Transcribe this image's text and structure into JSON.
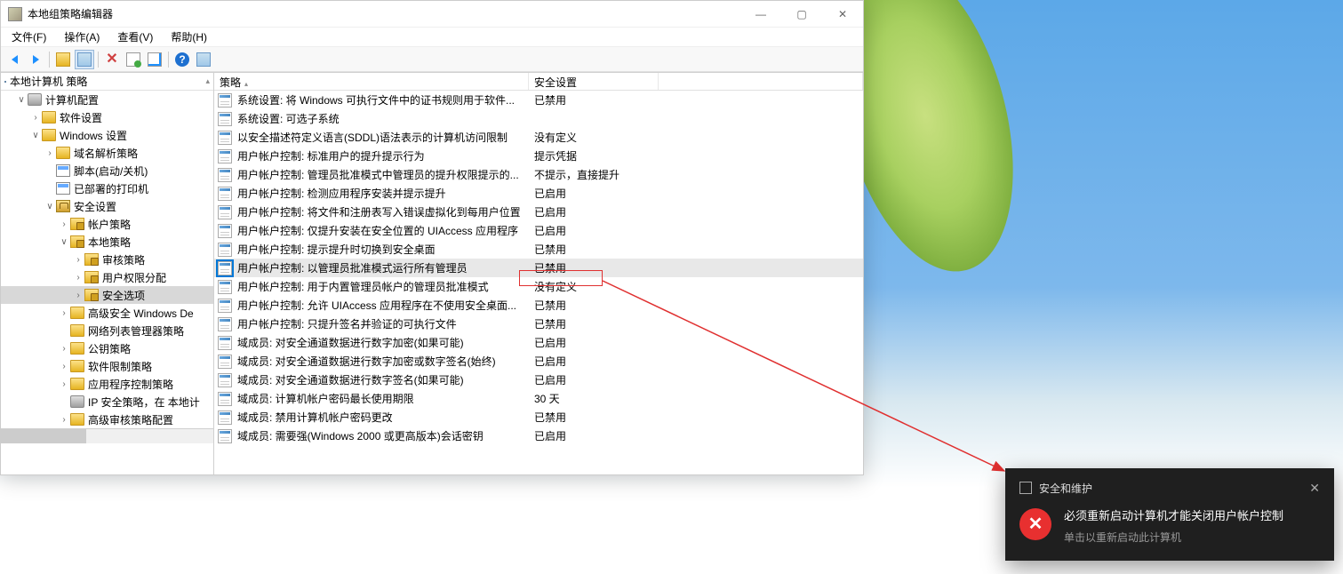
{
  "window": {
    "title": "本地组策略编辑器",
    "menus": [
      "文件(F)",
      "操作(A)",
      "查看(V)",
      "帮助(H)"
    ],
    "min": "—",
    "max": "▢",
    "close": "✕"
  },
  "tree": {
    "root": "本地计算机 策略",
    "n_computer": "计算机配置",
    "n_software": "软件设置",
    "n_windows": "Windows 设置",
    "n_dns": "域名解析策略",
    "n_script": "脚本(启动/关机)",
    "n_printer": "已部署的打印机",
    "n_security": "安全设置",
    "n_account": "帐户策略",
    "n_local": "本地策略",
    "n_audit": "审核策略",
    "n_rights": "用户权限分配",
    "n_options": "安全选项",
    "n_winde": "高级安全 Windows De",
    "n_netlist": "网络列表管理器策略",
    "n_pubkey": "公钥策略",
    "n_swrestrict": "软件限制策略",
    "n_appctrl": "应用程序控制策略",
    "n_ipsec": "IP 安全策略，在 本地计",
    "n_advaudit": "高级审核策略配置"
  },
  "list": {
    "col_policy": "策略",
    "col_setting": "安全设置",
    "rows": [
      {
        "p": "系统设置: 将 Windows 可执行文件中的证书规则用于软件...",
        "s": "已禁用"
      },
      {
        "p": "系统设置: 可选子系统",
        "s": ""
      },
      {
        "p": "以安全描述符定义语言(SDDL)语法表示的计算机访问限制",
        "s": "没有定义"
      },
      {
        "p": "用户帐户控制: 标准用户的提升提示行为",
        "s": "提示凭据"
      },
      {
        "p": "用户帐户控制: 管理员批准模式中管理员的提升权限提示的...",
        "s": "不提示，直接提升"
      },
      {
        "p": "用户帐户控制: 检测应用程序安装并提示提升",
        "s": "已启用"
      },
      {
        "p": "用户帐户控制: 将文件和注册表写入错误虚拟化到每用户位置",
        "s": "已启用"
      },
      {
        "p": "用户帐户控制: 仅提升安装在安全位置的 UIAccess 应用程序",
        "s": "已启用"
      },
      {
        "p": "用户帐户控制: 提示提升时切换到安全桌面",
        "s": "已禁用"
      },
      {
        "p": "用户帐户控制: 以管理员批准模式运行所有管理员",
        "s": "已禁用",
        "sel": true
      },
      {
        "p": "用户帐户控制: 用于内置管理员帐户的管理员批准模式",
        "s": "没有定义"
      },
      {
        "p": "用户帐户控制: 允许 UIAccess 应用程序在不使用安全桌面...",
        "s": "已禁用"
      },
      {
        "p": "用户帐户控制: 只提升签名并验证的可执行文件",
        "s": "已禁用"
      },
      {
        "p": "域成员: 对安全通道数据进行数字加密(如果可能)",
        "s": "已启用"
      },
      {
        "p": "域成员: 对安全通道数据进行数字加密或数字签名(始终)",
        "s": "已启用"
      },
      {
        "p": "域成员: 对安全通道数据进行数字签名(如果可能)",
        "s": "已启用"
      },
      {
        "p": "域成员: 计算机帐户密码最长使用期限",
        "s": "30 天"
      },
      {
        "p": "域成员: 禁用计算机帐户密码更改",
        "s": "已禁用"
      },
      {
        "p": "域成员: 需要强(Windows 2000 或更高版本)会话密钥",
        "s": "已启用"
      }
    ]
  },
  "notif": {
    "app": "安全和维护",
    "title": "必须重新启动计算机才能关闭用户帐户控制",
    "sub": "单击以重新启动此计算机",
    "x": "✕",
    "icon": "✕"
  }
}
